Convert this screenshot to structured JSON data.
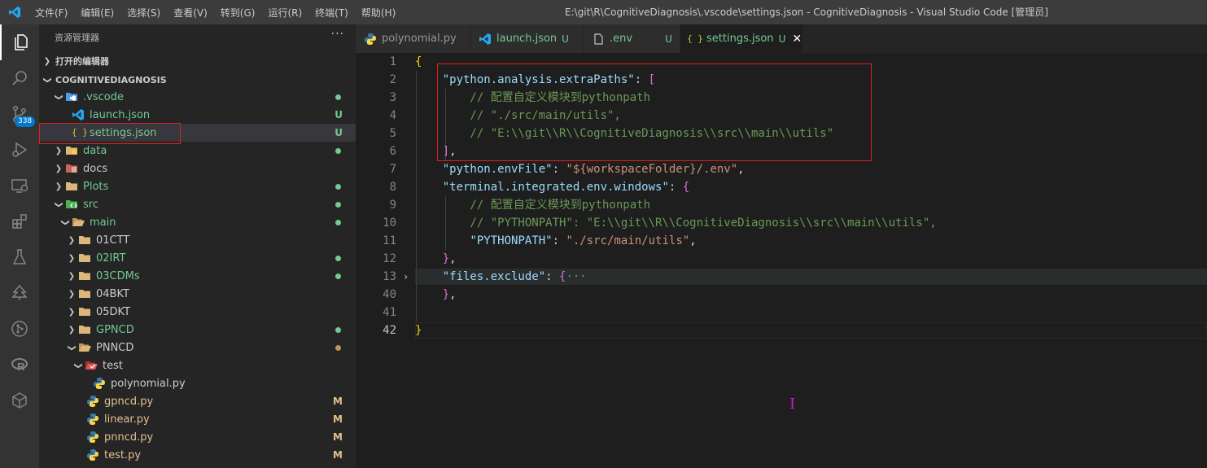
{
  "titlebar": {
    "menu": [
      "文件(F)",
      "编辑(E)",
      "选择(S)",
      "查看(V)",
      "转到(G)",
      "运行(R)",
      "终端(T)",
      "帮助(H)"
    ],
    "window_title": "E:\\git\\R\\CognitiveDiagnosis\\.vscode\\settings.json - CognitiveDiagnosis - Visual Studio Code [管理员]"
  },
  "activitybar": {
    "icons": [
      "explorer-icon",
      "search-icon",
      "source-control-icon",
      "run-debug-icon",
      "remote-explorer-icon",
      "extensions-icon",
      "testing-icon",
      "tree-icon",
      "git-graph-icon",
      "r-icon",
      "cube-icon"
    ],
    "scm_badge": "338"
  },
  "sidebar": {
    "title": "资源管理器",
    "more": "···",
    "open_editors": "打开的编辑器",
    "workspace": "COGNITIVEDIAGNOSIS",
    "items": [
      {
        "label": ".vscode",
        "status": "",
        "color": "#73c991"
      },
      {
        "label": "launch.json",
        "status": "U",
        "color": "#73c991"
      },
      {
        "label": "settings.json",
        "status": "U",
        "color": "#73c991"
      },
      {
        "label": "data",
        "status": "",
        "color": "#73c991"
      },
      {
        "label": "docs",
        "status": "",
        "color": "#cccccc"
      },
      {
        "label": "Plots",
        "status": "",
        "color": "#73c991"
      },
      {
        "label": "src",
        "status": "",
        "color": "#73c991"
      },
      {
        "label": "main",
        "status": "",
        "color": "#73c991"
      },
      {
        "label": "01CTT",
        "status": "",
        "color": "#cccccc"
      },
      {
        "label": "02IRT",
        "status": "",
        "color": "#73c991"
      },
      {
        "label": "03CDMs",
        "status": "",
        "color": "#73c991"
      },
      {
        "label": "04BKT",
        "status": "",
        "color": "#cccccc"
      },
      {
        "label": "05DKT",
        "status": "",
        "color": "#cccccc"
      },
      {
        "label": "GPNCD",
        "status": "",
        "color": "#73c991"
      },
      {
        "label": "PNNCD",
        "status": "",
        "color": "#cccccc"
      },
      {
        "label": "test",
        "status": "",
        "color": "#cccccc"
      },
      {
        "label": "polynomial.py",
        "status": "",
        "color": "#cccccc"
      },
      {
        "label": "gpncd.py",
        "status": "M",
        "color": "#e2c08d"
      },
      {
        "label": "linear.py",
        "status": "M",
        "color": "#e2c08d"
      },
      {
        "label": "pnncd.py",
        "status": "M",
        "color": "#e2c08d"
      },
      {
        "label": "test.py",
        "status": "M",
        "color": "#e2c08d"
      }
    ]
  },
  "tabs": [
    {
      "label": "polynomial.py",
      "status": "",
      "icon": "python-icon"
    },
    {
      "label": "launch.json",
      "status": "U",
      "icon": "vscode-icon"
    },
    {
      "label": ".env",
      "status": "U",
      "icon": "file-icon"
    },
    {
      "label": "settings.json",
      "status": "U",
      "icon": "json-icon",
      "close": "✕"
    }
  ],
  "editor": {
    "line_numbers": [
      "1",
      "2",
      "3",
      "4",
      "5",
      "6",
      "7",
      "8",
      "9",
      "10",
      "11",
      "12",
      "13",
      "40",
      "41",
      "42"
    ],
    "fold_marker": "›",
    "lines": [
      [
        {
          "t": "{",
          "c": "b1"
        }
      ],
      [
        {
          "t": "    ",
          "c": "p"
        },
        {
          "t": "\"python.analysis.extraPaths\"",
          "c": "k"
        },
        {
          "t": ": ",
          "c": "p"
        },
        {
          "t": "[",
          "c": "b2"
        }
      ],
      [
        {
          "t": "        // 配置自定义模块到pythonpath",
          "c": "c"
        }
      ],
      [
        {
          "t": "        // \"./src/main/utils\",",
          "c": "c"
        }
      ],
      [
        {
          "t": "        // \"E:\\\\git\\\\R\\\\CognitiveDiagnosis\\\\src\\\\main\\\\utils\"",
          "c": "c"
        }
      ],
      [
        {
          "t": "    ",
          "c": "p"
        },
        {
          "t": "]",
          "c": "b2"
        },
        {
          "t": ",",
          "c": "p"
        }
      ],
      [
        {
          "t": "    ",
          "c": "p"
        },
        {
          "t": "\"python.envFile\"",
          "c": "k"
        },
        {
          "t": ": ",
          "c": "p"
        },
        {
          "t": "\"${workspaceFolder}/.env\"",
          "c": "s"
        },
        {
          "t": ",",
          "c": "p"
        }
      ],
      [
        {
          "t": "    ",
          "c": "p"
        },
        {
          "t": "\"terminal.integrated.env.windows\"",
          "c": "k"
        },
        {
          "t": ": ",
          "c": "p"
        },
        {
          "t": "{",
          "c": "b2"
        }
      ],
      [
        {
          "t": "        // 配置自定义模块到pythonpath",
          "c": "c"
        }
      ],
      [
        {
          "t": "        // \"PYTHONPATH\": \"E:\\\\git\\\\R\\\\CognitiveDiagnosis\\\\src\\\\main\\\\utils\",",
          "c": "c"
        }
      ],
      [
        {
          "t": "        ",
          "c": "p"
        },
        {
          "t": "\"PYTHONPATH\"",
          "c": "k"
        },
        {
          "t": ": ",
          "c": "p"
        },
        {
          "t": "\"./src/main/utils\"",
          "c": "s"
        },
        {
          "t": ",",
          "c": "p"
        }
      ],
      [
        {
          "t": "    ",
          "c": "p"
        },
        {
          "t": "}",
          "c": "b2"
        },
        {
          "t": ",",
          "c": "p"
        }
      ],
      [
        {
          "t": "    ",
          "c": "p"
        },
        {
          "t": "\"files.exclude\"",
          "c": "k"
        },
        {
          "t": ": ",
          "c": "p"
        },
        {
          "t": "{",
          "c": "b2"
        },
        {
          "t": "···",
          "c": "e"
        }
      ],
      [
        {
          "t": "    ",
          "c": "p"
        },
        {
          "t": "}",
          "c": "b2"
        },
        {
          "t": ",",
          "c": "p"
        }
      ],
      [
        {
          "t": "",
          "c": "p"
        }
      ],
      [
        {
          "t": "}",
          "c": "b1"
        }
      ]
    ]
  },
  "colors": {
    "accent": "#007acc",
    "highlight_box": "#e02020"
  }
}
